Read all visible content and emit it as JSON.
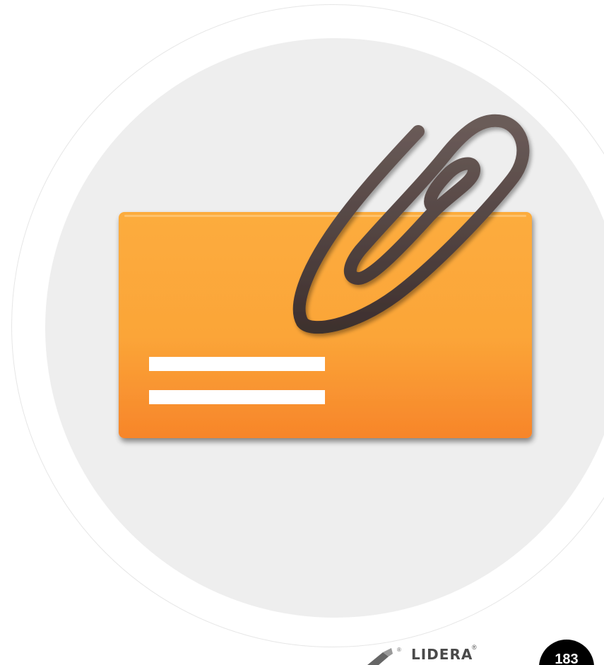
{
  "brand": {
    "name": "LIDERA",
    "registered": "®"
  },
  "page": {
    "number": "183"
  },
  "illustration": {
    "icons": [
      "document-card-icon",
      "paperclip-icon"
    ],
    "colors": {
      "card_top": "#FBA93C",
      "card_bottom": "#F8892A",
      "card_lines": "#FFFFFF",
      "paperclip": "#5A4B48",
      "disc": "#EEEEEE",
      "ring": "#E6E6E6",
      "badge": "#000000"
    }
  }
}
